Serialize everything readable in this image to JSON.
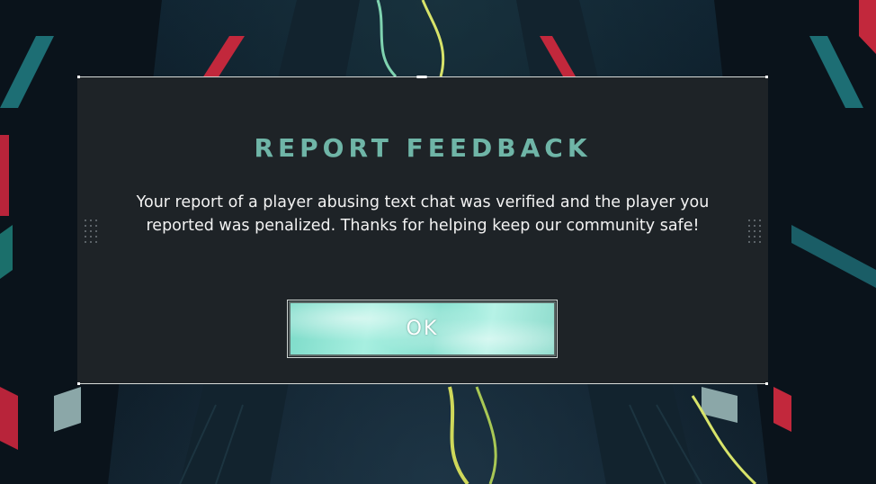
{
  "dialog": {
    "title": "REPORT FEEDBACK",
    "message": "Your report of a player abusing text chat was verified and the player you reported was penalized. Thanks for helping keep our community safe!",
    "ok_label": "OK"
  },
  "colors": {
    "title": "#6fb5a7",
    "panel": "#1e2327",
    "button": "#8fe3d2",
    "text": "#f2f2f2"
  }
}
